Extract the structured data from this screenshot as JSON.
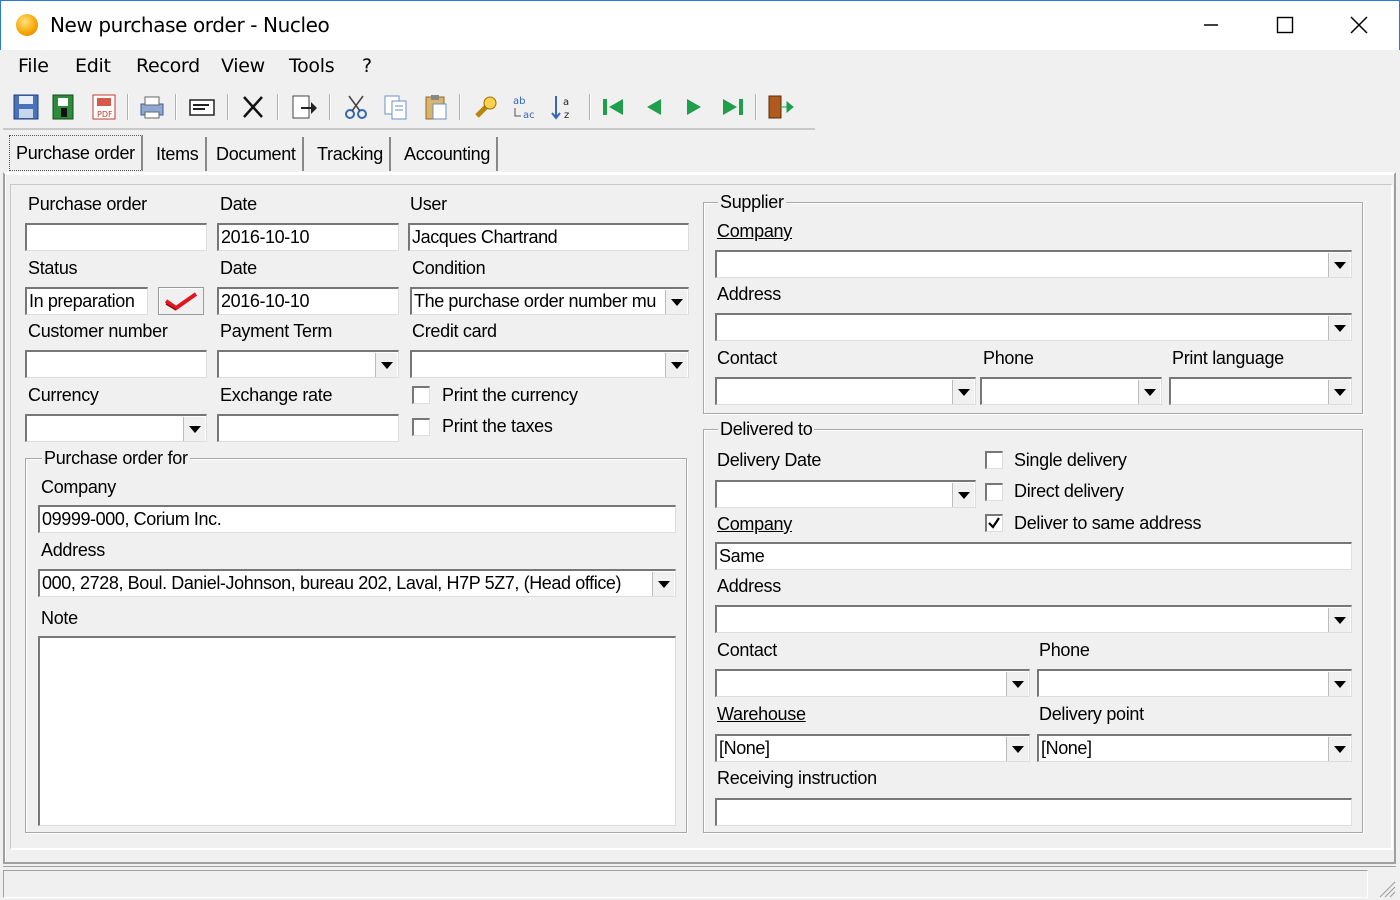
{
  "window": {
    "title": "New purchase order - Nucleo"
  },
  "menu": [
    "File",
    "Edit",
    "Record",
    "View",
    "Tools",
    "?"
  ],
  "toolbar": [
    "save-icon",
    "save-close-icon",
    "pdf-icon",
    "print-icon",
    "email-icon",
    "delete-icon",
    "export-icon",
    "cut-icon",
    "copy-icon",
    "paste-icon",
    "find-icon",
    "replace-icon",
    "sort-icon",
    "first-record-icon",
    "previous-record-icon",
    "next-record-icon",
    "last-record-icon",
    "exit-icon"
  ],
  "tabs": [
    "Purchase order",
    "Items",
    "Document",
    "Tracking",
    "Accounting"
  ],
  "header": {
    "purchase_order_label": "Purchase order",
    "purchase_order_value": "",
    "date_label": "Date",
    "date_value": "2016-10-10",
    "user_label": "User",
    "user_value": "Jacques Chartrand",
    "status_label": "Status",
    "status_value": "In preparation",
    "date2_label": "Date",
    "date2_value": "2016-10-10",
    "condition_label": "Condition",
    "condition_value": "The purchase order number mu",
    "customer_number_label": "Customer number",
    "customer_number_value": "",
    "payment_term_label": "Payment Term",
    "payment_term_value": "",
    "credit_card_label": "Credit card",
    "credit_card_value": "",
    "currency_label": "Currency",
    "currency_value": "",
    "exchange_rate_label": "Exchange rate",
    "exchange_rate_value": "",
    "print_currency_label": "Print the currency",
    "print_currency_checked": false,
    "print_taxes_label": "Print the taxes",
    "print_taxes_checked": false
  },
  "purchase_order_for": {
    "title": "Purchase order for",
    "company_label": "Company",
    "company_value": "09999-000, Corium Inc.",
    "address_label": "Address",
    "address_value": "000, 2728, Boul. Daniel-Johnson, bureau 202, Laval, H7P 5Z7, (Head office)",
    "note_label": "Note",
    "note_value": ""
  },
  "supplier": {
    "title": "Supplier",
    "company_label": "Company",
    "company_value": "",
    "address_label": "Address",
    "address_value": "",
    "contact_label": "Contact",
    "contact_value": "",
    "phone_label": "Phone",
    "phone_value": "",
    "print_language_label": "Print language",
    "print_language_value": ""
  },
  "delivered_to": {
    "title": "Delivered to",
    "delivery_date_label": "Delivery Date",
    "delivery_date_value": "",
    "single_delivery_label": "Single delivery",
    "single_delivery_checked": false,
    "direct_delivery_label": "Direct delivery",
    "direct_delivery_checked": false,
    "same_address_label": "Deliver to same address",
    "same_address_checked": true,
    "company_label": "Company",
    "company_value": "Same",
    "address_label": "Address",
    "address_value": "",
    "contact_label": "Contact",
    "contact_value": "",
    "phone_label": "Phone",
    "phone_value": "",
    "warehouse_label": "Warehouse",
    "warehouse_value": "[None]",
    "delivery_point_label": "Delivery point",
    "delivery_point_value": "[None]",
    "receiving_instruction_label": "Receiving instruction",
    "receiving_instruction_value": ""
  },
  "colors": {
    "accent_border": "#2b78d4",
    "window_bg": "#f0f0f0",
    "checkmark": "#e2161f"
  }
}
